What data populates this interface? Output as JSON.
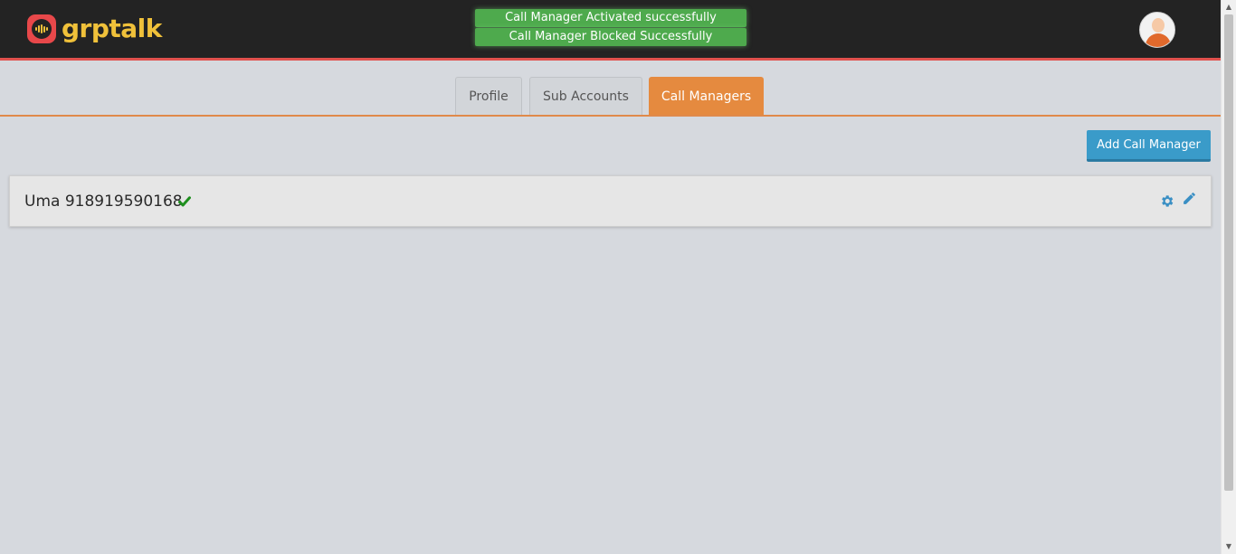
{
  "header": {
    "logo_text": "grptalk",
    "brand_color": "#f0c13a",
    "accent_color": "#e0514d",
    "notifications": [
      "Call Manager Activated successfully",
      "Call Manager Blocked Successfully"
    ],
    "avatar_icon": "user-avatar-icon"
  },
  "tabs": [
    {
      "label": "Profile",
      "active": false
    },
    {
      "label": "Sub Accounts",
      "active": false
    },
    {
      "label": "Call Managers",
      "active": true
    }
  ],
  "toolbar": {
    "add_label": "Add Call Manager"
  },
  "call_managers": [
    {
      "name_number": "Uma 918919590168",
      "status_icon": "check-icon",
      "status_color": "#1e8f1e",
      "actions": [
        "gear-icon",
        "pencil-icon"
      ]
    }
  ]
}
